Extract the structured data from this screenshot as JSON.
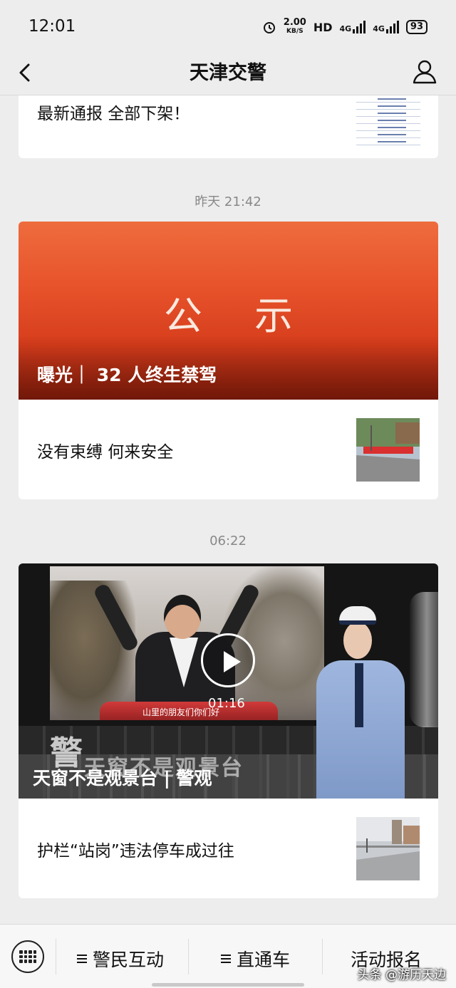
{
  "status": {
    "time": "12:01",
    "speed_value": "2.00",
    "speed_unit": "KB/S",
    "hd": "HD",
    "net1": "4G",
    "net2": "4G",
    "battery": "93"
  },
  "nav": {
    "title": "天津交警"
  },
  "feed": {
    "top_card": {
      "title": "最新通报 全部下架！"
    },
    "time_1": "昨天 21:42",
    "cover_card": {
      "cover_text": "公 示",
      "cover_caption": "曝光｜ 32 人终生禁驾",
      "item_title": "没有束缚 何来安全"
    },
    "time_2": "06:22",
    "video_card": {
      "subtitle": "山里的朋友们你们好",
      "duration": "01:16",
      "watermark": "警",
      "overlay_text": "天窗不是观景台",
      "caption": "天窗不是观景台 | 警观",
      "item_title": "护栏“站岗”违法停车成过往"
    }
  },
  "tabbar": {
    "tab1": "警民互动",
    "tab2": "直通车",
    "tab3": "活动报名",
    "attribution": "头条 @游历天边"
  },
  "colors": {
    "background": "#ededed",
    "cover_orange": "#e8542c",
    "timestamp": "#888888"
  }
}
